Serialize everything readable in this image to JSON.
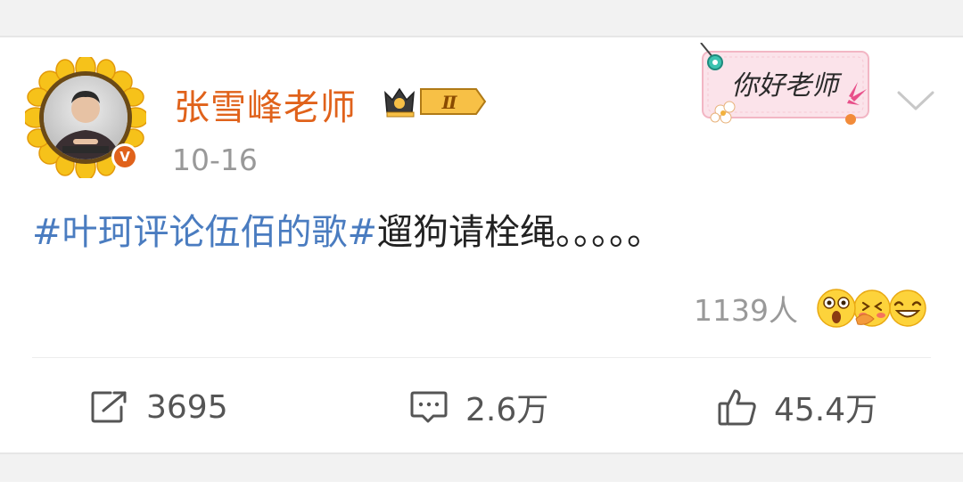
{
  "post": {
    "username": "张雪峰老师",
    "vip_level": "Ⅱ",
    "date": "10-16",
    "deco_card_text": "你好老师",
    "text": {
      "hashtag": "#叶珂评论伍佰的歌#",
      "body": "遛狗请栓绳。。。。。"
    },
    "reactions": {
      "count": "1139人",
      "emojis": [
        "surprised-emoji-icon",
        "hugging-emoji-icon",
        "grinning-emoji-icon"
      ]
    },
    "actions": {
      "repost_count": "3695",
      "comment_count": "2.6万",
      "like_count": "45.4万"
    }
  },
  "colors": {
    "username": "#e0621b",
    "hashtag": "#4a7cc0",
    "secondary_text": "#999999",
    "background": "#f2f2f2",
    "verified_badge": "#e0621b"
  }
}
